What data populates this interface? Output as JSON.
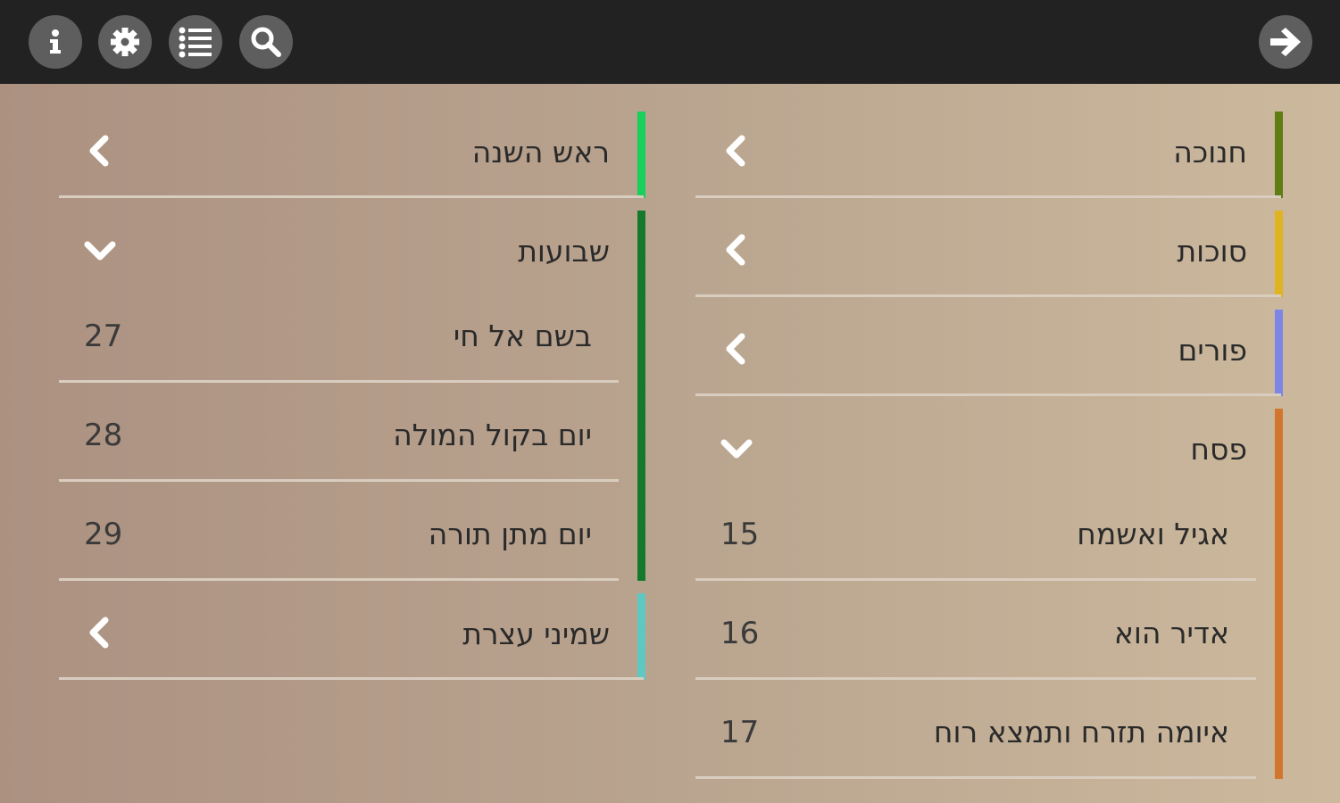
{
  "toolbar": {
    "info_icon": "info-icon",
    "settings_icon": "gear-icon",
    "list_icon": "list-icon",
    "search_icon": "search-icon",
    "forward_icon": "arrow-right-icon"
  },
  "right_column": {
    "groups": [
      {
        "label": "חנוכה",
        "color": "#5f7d12",
        "expanded": false
      },
      {
        "label": "סוכות",
        "color": "#e0b420",
        "expanded": false
      },
      {
        "label": "פורים",
        "color": "#7d86e6",
        "expanded": false
      },
      {
        "label": "פסח",
        "color": "#d2762e",
        "expanded": true,
        "items": [
          {
            "title": "אגיל ואשמח",
            "number": "15"
          },
          {
            "title": "אדיר הוא",
            "number": "16"
          },
          {
            "title": "איומה תזרח ותמצא רוח",
            "number": "17"
          }
        ]
      }
    ]
  },
  "left_column": {
    "groups": [
      {
        "label": "ראש השנה",
        "color": "#17d15a",
        "expanded": false
      },
      {
        "label": "שבועות",
        "color": "#137a2c",
        "expanded": true,
        "items": [
          {
            "title": "בשם אל חי",
            "number": "27"
          },
          {
            "title": "יום בקול המולה",
            "number": "28"
          },
          {
            "title": "יום מתן תורה",
            "number": "29"
          }
        ]
      },
      {
        "label": "שמיני עצרת",
        "color": "#5ec9c3",
        "expanded": false
      }
    ]
  }
}
